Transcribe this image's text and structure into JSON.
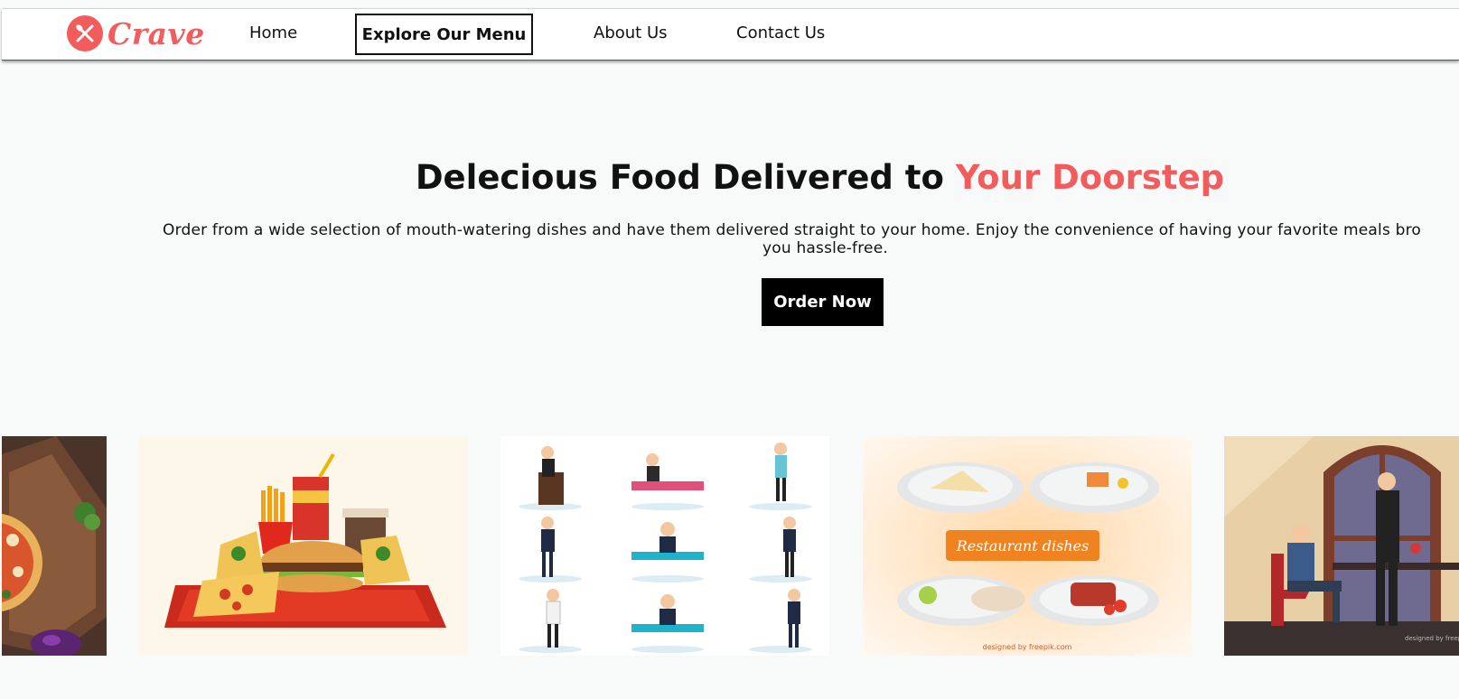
{
  "brand": {
    "name": "Crave",
    "color": "#f25c5c"
  },
  "nav": {
    "items": [
      {
        "label": "Home",
        "active": false
      },
      {
        "label": "Explore Our Menu",
        "active": true
      },
      {
        "label": "About Us",
        "active": false
      },
      {
        "label": "Contact Us",
        "active": false
      }
    ]
  },
  "hero": {
    "title_main": "Delecious Food Delivered to ",
    "title_accent": "Your Doorstep",
    "description_line1": "Order from a wide selection of mouth-watering dishes and have them delivered straight to your home. Enjoy the convenience of having your favorite meals bro",
    "description_line2": "you hassle-free.",
    "cta_label": "Order Now"
  },
  "gallery": {
    "banner_text": "Restaurant dishes",
    "credit_text": "designed by freepik.com",
    "credit_text_2": "designed by freepi"
  },
  "colors": {
    "accent": "#f25c5c",
    "button_bg": "#000000",
    "page_bg": "#f8fafa"
  }
}
